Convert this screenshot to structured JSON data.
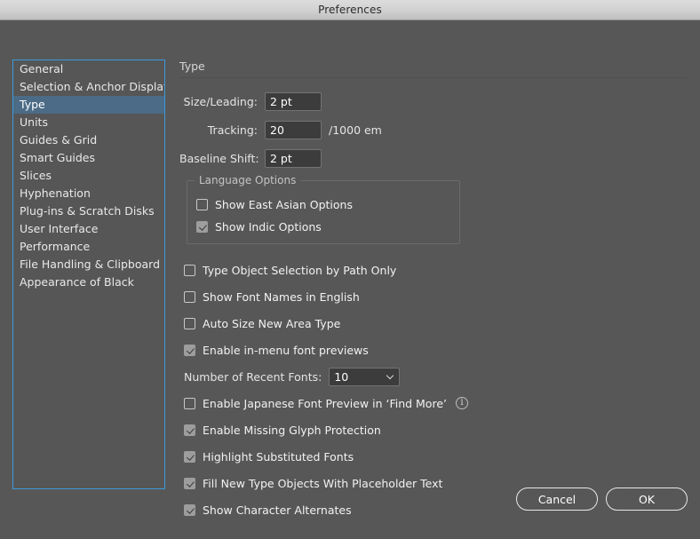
{
  "window": {
    "title": "Preferences",
    "accent_blue": "#3d9ad9",
    "selection_blue": "#4b6b86",
    "body_bg": "#575757"
  },
  "sidebar": {
    "items": [
      {
        "label": "General",
        "selected": false
      },
      {
        "label": "Selection & Anchor Display",
        "selected": false
      },
      {
        "label": "Type",
        "selected": true
      },
      {
        "label": "Units",
        "selected": false
      },
      {
        "label": "Guides & Grid",
        "selected": false
      },
      {
        "label": "Smart Guides",
        "selected": false
      },
      {
        "label": "Slices",
        "selected": false
      },
      {
        "label": "Hyphenation",
        "selected": false
      },
      {
        "label": "Plug-ins & Scratch Disks",
        "selected": false
      },
      {
        "label": "User Interface",
        "selected": false
      },
      {
        "label": "Performance",
        "selected": false
      },
      {
        "label": "File Handling & Clipboard",
        "selected": false
      },
      {
        "label": "Appearance of Black",
        "selected": false
      }
    ]
  },
  "panel": {
    "title": "Type",
    "fields": [
      {
        "label": "Size/Leading:",
        "value": "2 pt",
        "suffix": ""
      },
      {
        "label": "Tracking:",
        "value": "20",
        "suffix": "/1000 em"
      },
      {
        "label": "Baseline Shift:",
        "value": "2 pt",
        "suffix": ""
      }
    ],
    "language_options": {
      "legend": "Language Options",
      "items": [
        {
          "label": "Show East Asian Options",
          "checked": false
        },
        {
          "label": "Show Indic Options",
          "checked": true
        }
      ]
    },
    "options_top": [
      {
        "label": "Type Object Selection by Path Only",
        "checked": false
      },
      {
        "label": "Show Font Names in English",
        "checked": false
      },
      {
        "label": "Auto Size New Area Type",
        "checked": false
      },
      {
        "label": "Enable in-menu font previews",
        "checked": true
      }
    ],
    "recent_fonts": {
      "label": "Number of Recent Fonts:",
      "value": "10",
      "icon": "chevron-down-icon"
    },
    "japanese_preview": {
      "label": "Enable Japanese Font Preview in ‘Find More’",
      "checked": false,
      "icon": "info-icon"
    },
    "options_bottom": [
      {
        "label": "Enable Missing Glyph Protection",
        "checked": true
      },
      {
        "label": "Highlight Substituted Fonts",
        "checked": true
      },
      {
        "label": "Fill New Type Objects With Placeholder Text",
        "checked": true
      },
      {
        "label": "Show Character Alternates",
        "checked": true
      }
    ]
  },
  "footer": {
    "cancel_label": "Cancel",
    "ok_label": "OK"
  }
}
